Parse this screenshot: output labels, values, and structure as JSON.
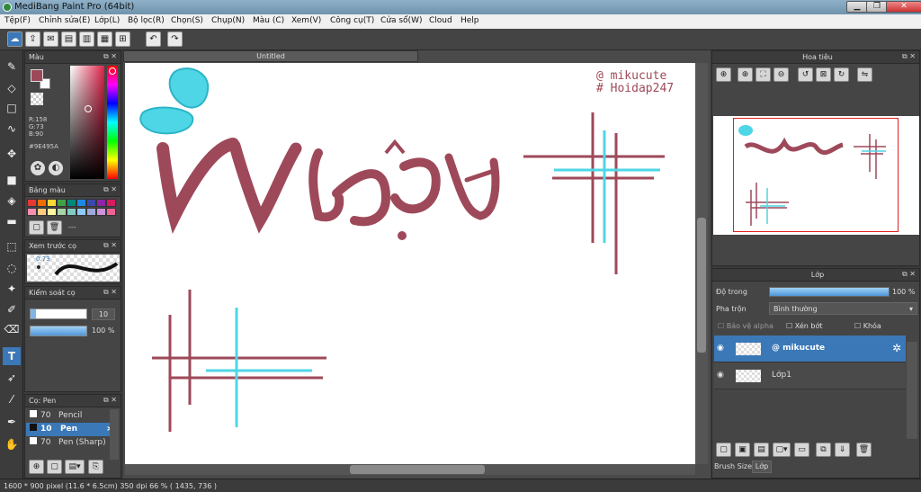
{
  "window": {
    "title": "MediBang Paint Pro (64bit)",
    "minimize": "▁",
    "maximize": "❐",
    "close": "✕"
  },
  "menu": [
    "Tệp(F)",
    "Chỉnh sửa(E)",
    "Lớp(L)",
    "Bộ lọc(R)",
    "Chọn(S)",
    "Chụp(N)",
    "Màu (C)",
    "Xem(V)",
    "Công cụ(T)",
    "Cửa sổ(W)",
    "Cloud",
    "Help"
  ],
  "toolbar_icons": [
    "cloud-icon",
    "share-icon",
    "comment-icon",
    "document-icon",
    "document-icon",
    "settings-icon",
    "grid-icon",
    "undo-icon",
    "redo-icon"
  ],
  "tools": [
    "brush-icon",
    "eraser-icon",
    "rectangle-icon",
    "curve-icon",
    "move-icon",
    "fill-rect-icon",
    "bucket-icon",
    "gradient-icon",
    "select-rect-icon",
    "lasso-icon",
    "magic-wand-icon",
    "select-pen-icon",
    "select-eraser-icon",
    "text-icon",
    "operation-icon",
    "dropper-icon",
    "hand-icon"
  ],
  "color_panel": {
    "title": "Màu",
    "r": "R:158",
    "g": "G:73",
    "b": "B:90",
    "hex": "#9E495A",
    "fg_color": "#9E495A",
    "bg_color": "#FFFFFF"
  },
  "palette": {
    "title": "Bảng màu",
    "placeholder": "---",
    "colors": [
      "#e53935",
      "#ef6c00",
      "#fdd835",
      "#43a047",
      "#00897b",
      "#1e88e5",
      "#3949ab",
      "#8e24aa",
      "#d81b60",
      "#f48fb1",
      "#ffcc80",
      "#fff59d",
      "#a5d6a7",
      "#80cbc4",
      "#90caf9",
      "#9fa8da",
      "#ce93d8",
      "#f06292"
    ]
  },
  "preview": {
    "title": "Xem trước cọ",
    "size": "0.73"
  },
  "brush_control": {
    "title": "Kiểm soát cọ",
    "size_value": "10",
    "opacity_value": "100 %",
    "size_fraction": 0.1,
    "opacity_fraction": 1.0
  },
  "brush_list": {
    "title": "Cọ: Pen",
    "items": [
      {
        "size": "70",
        "name": "Pencil",
        "selected": false
      },
      {
        "size": "10",
        "name": "Pen",
        "selected": true
      },
      {
        "size": "70",
        "name": "Pen (Sharp)",
        "selected": false
      }
    ]
  },
  "document": {
    "tab": "Untitled",
    "watermark1": "@ mikucute",
    "watermark2": "# Hoidap247",
    "lettering": "Việt"
  },
  "navigator": {
    "title": "Hoa tiêu",
    "icons": [
      "zoom-in-icon",
      "zoom-out-icon",
      "fit-icon",
      "actual-size-icon",
      "rotate-left-icon",
      "rotate-reset-icon",
      "rotate-right-icon",
      "flip-icon"
    ]
  },
  "layers": {
    "title": "Lớp",
    "opacity_label": "Độ trong",
    "opacity_value": "100 %",
    "opacity_fraction": 1.0,
    "blend_label": "Pha trộn",
    "blend_value": "Bình thường",
    "protect_alpha": "Bảo vệ alpha",
    "clipping": "Xén bớt",
    "lock": "Khóa",
    "items": [
      {
        "name": "@ mikucute",
        "selected": true
      },
      {
        "name": "Lớp1",
        "selected": false
      }
    ],
    "tabs": [
      "Brush Size",
      "Lớp"
    ]
  },
  "status": {
    "text": "1600 * 900 pixel   (11.6 * 6.5cm)   350 dpi   66 %   ( 1435, 736 )"
  }
}
